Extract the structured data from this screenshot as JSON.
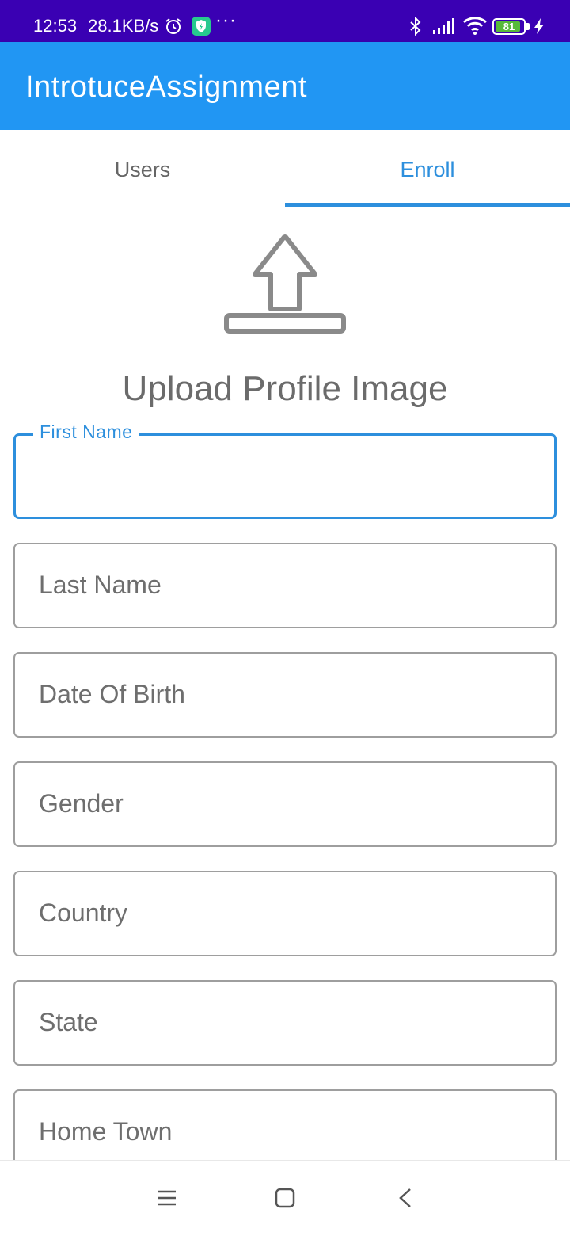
{
  "status_bar": {
    "time": "12:53",
    "net_speed": "28.1KB/s",
    "battery_level": "81",
    "icons": [
      "alarm-icon",
      "shield-app-icon",
      "more-dots-icon",
      "bluetooth-icon",
      "signal-icon",
      "wifi-icon",
      "battery-icon",
      "charging-icon"
    ]
  },
  "app_bar": {
    "title": "IntrotuceAssignment",
    "color": "#2196f3"
  },
  "tabs": [
    {
      "label": "Users",
      "selected": false
    },
    {
      "label": "Enroll",
      "selected": true
    }
  ],
  "upload": {
    "icon": "upload-icon",
    "label": "Upload Profile Image"
  },
  "form": {
    "first_name": {
      "label": "First Name",
      "value": ""
    },
    "last_name": {
      "placeholder": "Last Name"
    },
    "dob": {
      "placeholder": "Date Of Birth"
    },
    "gender": {
      "placeholder": "Gender"
    },
    "country": {
      "placeholder": "Country"
    },
    "state": {
      "placeholder": "State"
    },
    "home_town": {
      "placeholder": "Home Town"
    }
  },
  "nav_bar": {
    "icons": [
      "menu-icon",
      "home-square-icon",
      "back-chevron-icon"
    ]
  },
  "colors": {
    "status_bar": "#3a00b3",
    "accent": "#2d8fdd",
    "border": "#9e9e9e"
  }
}
